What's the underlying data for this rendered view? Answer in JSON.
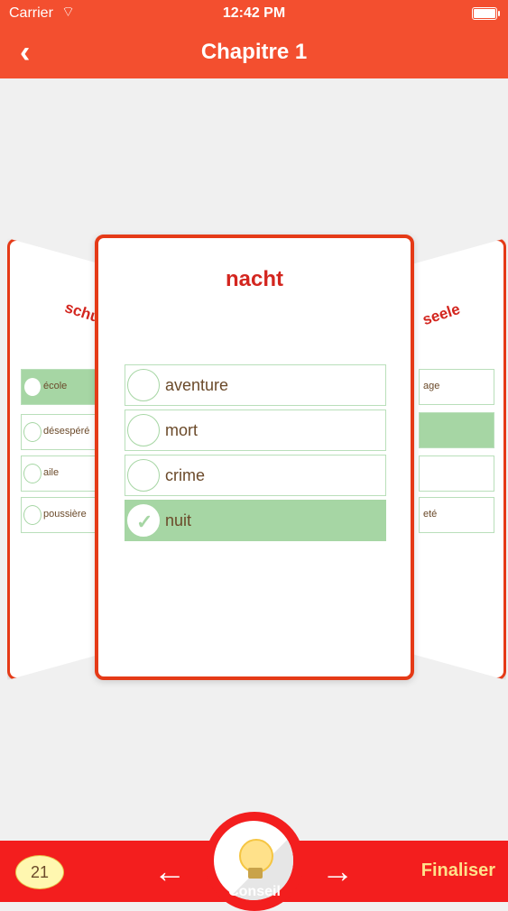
{
  "status_bar": {
    "carrier": "Carrier",
    "time": "12:42 PM"
  },
  "nav": {
    "title": "Chapitre 1"
  },
  "cards": {
    "left": {
      "word": "schule",
      "options": [
        {
          "label": "école",
          "selected": true
        },
        {
          "label": "désespéré",
          "selected": false
        },
        {
          "label": "aile",
          "selected": false
        },
        {
          "label": "poussière",
          "selected": false
        }
      ]
    },
    "main": {
      "word": "nacht",
      "options": [
        {
          "label": "aventure",
          "selected": false
        },
        {
          "label": "mort",
          "selected": false
        },
        {
          "label": "crime",
          "selected": false
        },
        {
          "label": "nuit",
          "selected": true
        }
      ]
    },
    "right": {
      "word": "seele",
      "options": [
        {
          "label": "age",
          "selected": false
        },
        {
          "label": "",
          "selected": true
        },
        {
          "label": "",
          "selected": false
        },
        {
          "label": "eté",
          "selected": false
        }
      ]
    }
  },
  "bottom_bar": {
    "count": "21",
    "hint_label": "Conseil",
    "finalize_label": "Finaliser"
  },
  "colors": {
    "accent": "#f34f2f",
    "card_border": "#e53a17",
    "selected": "#a6d6a4",
    "bottom_bar": "#f31e1e"
  }
}
